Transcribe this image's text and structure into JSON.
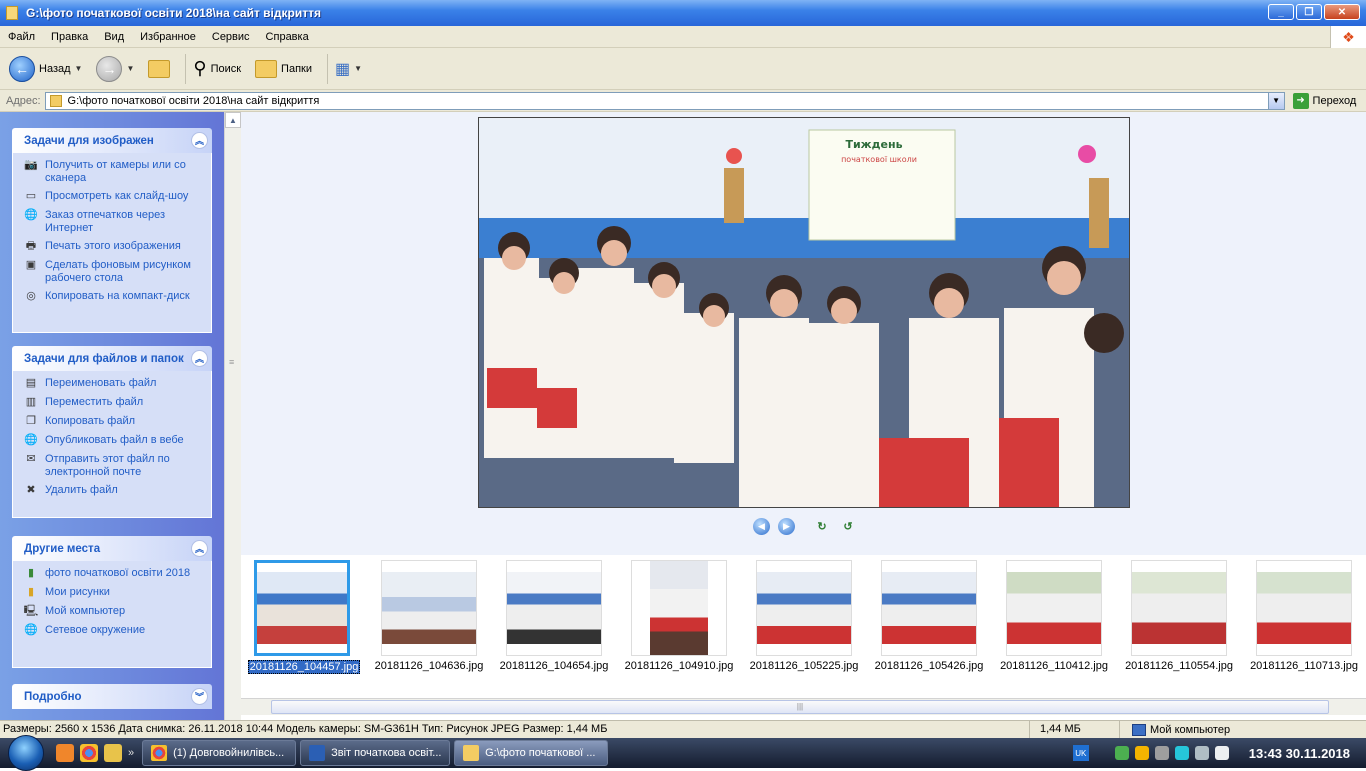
{
  "window": {
    "title": "G:\\фото початкової освіти 2018\\на сайт відкриття",
    "controls": {
      "minimize": "_",
      "maximize": "❐",
      "close": "✕"
    }
  },
  "menu": [
    "Файл",
    "Правка",
    "Вид",
    "Избранное",
    "Сервис",
    "Справка"
  ],
  "toolbar": {
    "back": "Назад",
    "search": "Поиск",
    "folders": "Папки"
  },
  "address": {
    "label": "Адрес:",
    "value": "G:\\фото початкової освіти 2018\\на сайт відкриття",
    "go": "Переход"
  },
  "panels": {
    "image_tasks": {
      "title": "Задачи для изображен",
      "items": [
        "Получить от камеры или со сканера",
        "Просмотреть как слайд-шоу",
        "Заказ отпечатков через Интернет",
        "Печать этого изображения",
        "Сделать фоновым рисунком рабочего стола",
        "Копировать на компакт-диск"
      ]
    },
    "file_tasks": {
      "title": "Задачи для файлов и папок",
      "items": [
        "Переименовать файл",
        "Переместить файл",
        "Копировать файл",
        "Опубликовать файл в вебе",
        "Отправить этот файл по электронной почте",
        "Удалить файл"
      ]
    },
    "other_places": {
      "title": "Другие места",
      "items": [
        "фото початкової освіти 2018",
        "Мои рисунки",
        "Мой компьютер",
        "Сетевое окружение"
      ]
    },
    "details": {
      "title": "Подробно"
    }
  },
  "photo_poster": {
    "line1": "Тиждень",
    "line2": "початкової школи"
  },
  "thumbnails": [
    {
      "name": "20181126_104457.jpg",
      "selected": true,
      "portrait": false
    },
    {
      "name": "20181126_104636.jpg",
      "selected": false,
      "portrait": false
    },
    {
      "name": "20181126_104654.jpg",
      "selected": false,
      "portrait": false
    },
    {
      "name": "20181126_104910.jpg",
      "selected": false,
      "portrait": true
    },
    {
      "name": "20181126_105225.jpg",
      "selected": false,
      "portrait": false
    },
    {
      "name": "20181126_105426.jpg",
      "selected": false,
      "portrait": false
    },
    {
      "name": "20181126_110412.jpg",
      "selected": false,
      "portrait": false
    },
    {
      "name": "20181126_110554.jpg",
      "selected": false,
      "portrait": false
    },
    {
      "name": "20181126_110713.jpg",
      "selected": false,
      "portrait": false
    }
  ],
  "status": {
    "info": "Размеры: 2560 x 1536 Дата снимка: 26.11.2018 10:44 Модель камеры: SM-G361H Тип: Рисунок JPEG Размер: 1,44 МБ",
    "size": "1,44 МБ",
    "zone": "Мой компьютер"
  },
  "taskbar": {
    "tasks": [
      {
        "label": "(1) Довговойнилівсь...",
        "color": "#e8a33d"
      },
      {
        "label": "Звіт початкова освіт...",
        "color": "#2b5fb4"
      },
      {
        "label": "G:\\фото початкової ...",
        "color": "#f3cc63"
      }
    ],
    "lang": "UK",
    "clock": "13:43 30.11.2018"
  },
  "colors": {
    "accent": "#215dc6",
    "selection": "#316ac5",
    "titlebar": "#2866d9"
  }
}
